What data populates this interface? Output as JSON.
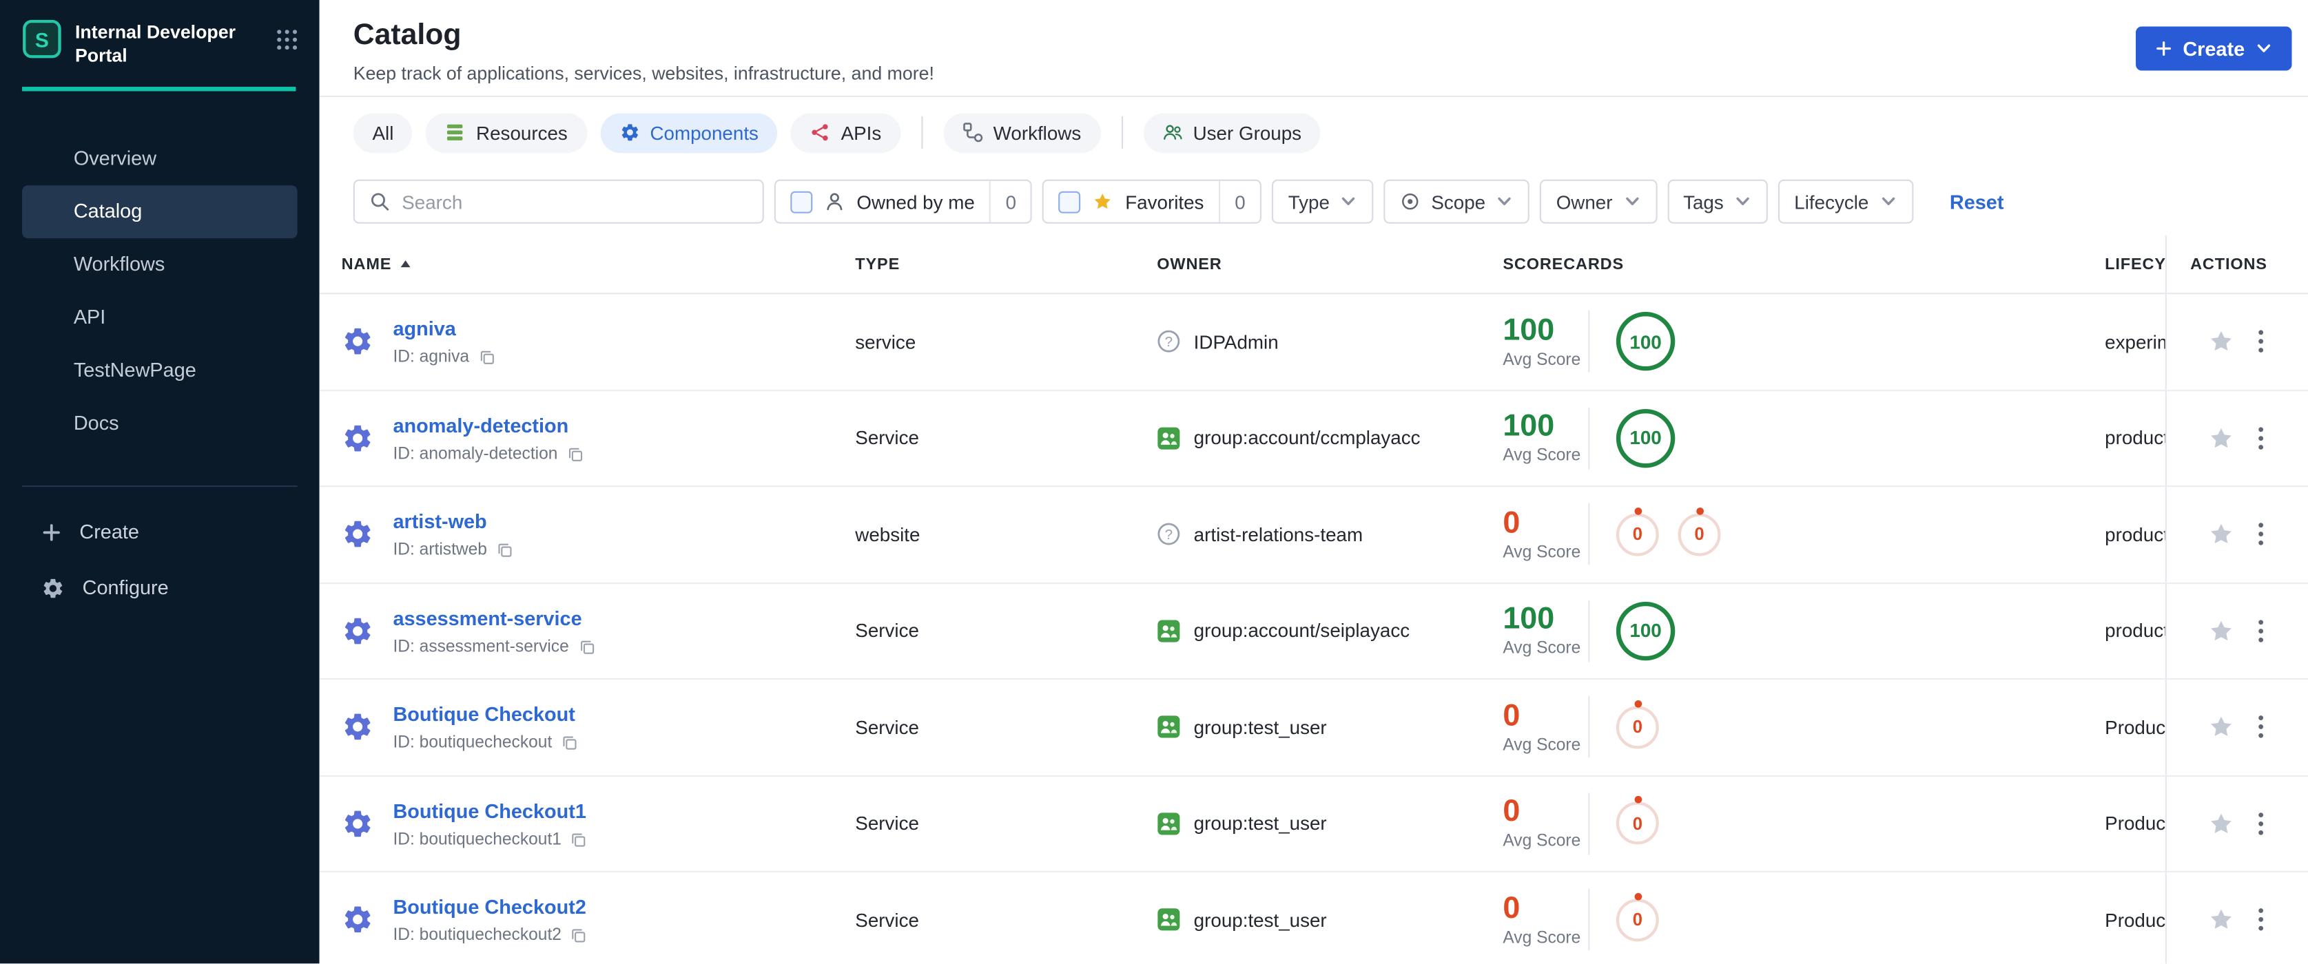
{
  "theme": {
    "accent_blue": "#2a5bd7",
    "link_blue": "#2e68d1",
    "green": "#1f8742",
    "red": "#e04a22",
    "sidebar_bg": "#0a1a29",
    "teal_accent": "#0cc3a8"
  },
  "sidebar": {
    "logo_title": "Internal Developer Portal",
    "items": [
      {
        "label": "Overview",
        "active": false
      },
      {
        "label": "Catalog",
        "active": true
      },
      {
        "label": "Workflows",
        "active": false
      },
      {
        "label": "API",
        "active": false
      },
      {
        "label": "TestNewPage",
        "active": false
      },
      {
        "label": "Docs",
        "active": false
      }
    ],
    "create_label": "Create",
    "configure_label": "Configure"
  },
  "header": {
    "title": "Catalog",
    "subtitle": "Keep track of applications, services, websites, infrastructure, and more!",
    "create_button": "Create"
  },
  "tabs": [
    {
      "label": "All",
      "selected": false
    },
    {
      "label": "Resources",
      "selected": false
    },
    {
      "label": "Components",
      "selected": true
    },
    {
      "label": "APIs",
      "selected": false
    },
    {
      "label": "Workflows",
      "selected": false
    },
    {
      "label": "User Groups",
      "selected": false
    }
  ],
  "filters": {
    "search_placeholder": "Search",
    "owned_by_me": {
      "label": "Owned by me",
      "count": "0",
      "checked": false
    },
    "favorites": {
      "label": "Favorites",
      "count": "0",
      "checked": false
    },
    "dropdowns": [
      "Type",
      "Scope",
      "Owner",
      "Tags",
      "Lifecycle"
    ],
    "reset_label": "Reset"
  },
  "table": {
    "columns": [
      "NAME",
      "TYPE",
      "OWNER",
      "SCORECARDS",
      "LIFECYCLE",
      "ACTIONS"
    ],
    "sort": {
      "column": "NAME",
      "direction": "asc"
    },
    "avg_score_label": "Avg Score",
    "rows": [
      {
        "name": "agniva",
        "id": "ID: agniva",
        "type": "service",
        "owner": "IDPAdmin",
        "owner_icon": "user",
        "avg": "100",
        "avg_color": "green",
        "badges": [
          {
            "value": "100",
            "variant": "green"
          }
        ],
        "lifecycle": "experimental"
      },
      {
        "name": "anomaly-detection",
        "id": "ID: anomaly-detection",
        "type": "Service",
        "owner": "group:account/ccmplayacc",
        "owner_icon": "group",
        "avg": "100",
        "avg_color": "green",
        "badges": [
          {
            "value": "100",
            "variant": "green"
          }
        ],
        "lifecycle": "production"
      },
      {
        "name": "artist-web",
        "id": "ID: artistweb",
        "type": "website",
        "owner": "artist-relations-team",
        "owner_icon": "user",
        "avg": "0",
        "avg_color": "red",
        "badges": [
          {
            "value": "0",
            "variant": "red"
          },
          {
            "value": "0",
            "variant": "red"
          }
        ],
        "lifecycle": "production"
      },
      {
        "name": "assessment-service",
        "id": "ID: assessment-service",
        "type": "Service",
        "owner": "group:account/seiplayacc",
        "owner_icon": "group",
        "avg": "100",
        "avg_color": "green",
        "badges": [
          {
            "value": "100",
            "variant": "green"
          }
        ],
        "lifecycle": "production"
      },
      {
        "name": "Boutique Checkout",
        "id": "ID: boutiquecheckout",
        "type": "Service",
        "owner": "group:test_user",
        "owner_icon": "group",
        "avg": "0",
        "avg_color": "red",
        "badges": [
          {
            "value": "0",
            "variant": "red"
          }
        ],
        "lifecycle": "Production"
      },
      {
        "name": "Boutique Checkout1",
        "id": "ID: boutiquecheckout1",
        "type": "Service",
        "owner": "group:test_user",
        "owner_icon": "group",
        "avg": "0",
        "avg_color": "red",
        "badges": [
          {
            "value": "0",
            "variant": "red"
          }
        ],
        "lifecycle": "Production"
      },
      {
        "name": "Boutique Checkout2",
        "id": "ID: boutiquecheckout2",
        "type": "Service",
        "owner": "group:test_user",
        "owner_icon": "group",
        "avg": "0",
        "avg_color": "red",
        "badges": [
          {
            "value": "0",
            "variant": "red"
          }
        ],
        "lifecycle": "Production"
      }
    ]
  }
}
